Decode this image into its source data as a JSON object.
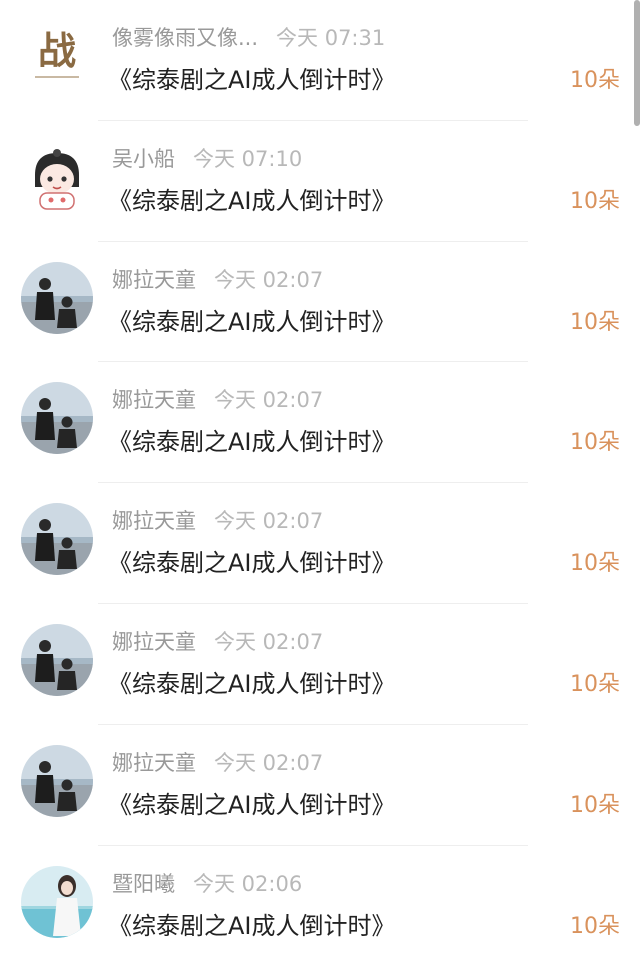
{
  "gift_records": [
    {
      "name": "像雾像雨又像...",
      "time": "今天 07:31",
      "book": "《综泰剧之AI成人倒计时》",
      "amount": "10朵",
      "avatar": "calligraphy-avatar",
      "avatar_text": "战"
    },
    {
      "name": "吴小船",
      "time": "今天 07:10",
      "book": "《综泰剧之AI成人倒计时》",
      "amount": "10朵",
      "avatar": "cartoon-girl-avatar"
    },
    {
      "name": "娜拉天童",
      "time": "今天 02:07",
      "book": "《综泰剧之AI成人倒计时》",
      "amount": "10朵",
      "avatar": "couple-photo-avatar"
    },
    {
      "name": "娜拉天童",
      "time": "今天 02:07",
      "book": "《综泰剧之AI成人倒计时》",
      "amount": "10朵",
      "avatar": "couple-photo-avatar"
    },
    {
      "name": "娜拉天童",
      "time": "今天 02:07",
      "book": "《综泰剧之AI成人倒计时》",
      "amount": "10朵",
      "avatar": "couple-photo-avatar"
    },
    {
      "name": "娜拉天童",
      "time": "今天 02:07",
      "book": "《综泰剧之AI成人倒计时》",
      "amount": "10朵",
      "avatar": "couple-photo-avatar"
    },
    {
      "name": "娜拉天童",
      "time": "今天 02:07",
      "book": "《综泰剧之AI成人倒计时》",
      "amount": "10朵",
      "avatar": "couple-photo-avatar"
    },
    {
      "name": "暨阳曦",
      "time": "今天 02:06",
      "book": "《综泰剧之AI成人倒计时》",
      "amount": "10朵",
      "avatar": "girl-photo-avatar"
    }
  ],
  "colors": {
    "name": "#999999",
    "time": "#b8b8b8",
    "book": "#222222",
    "amount": "#d9925c",
    "divider": "#eeeeee"
  }
}
